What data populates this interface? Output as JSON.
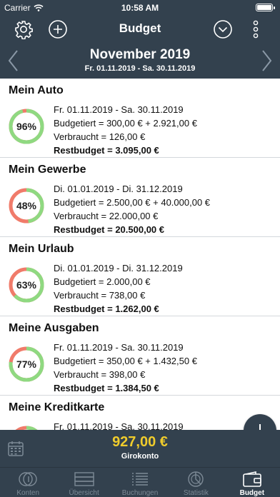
{
  "status": {
    "carrier": "Carrier",
    "time": "10:58 AM"
  },
  "header": {
    "title": "Budget"
  },
  "period": {
    "month": "November 2019",
    "range": "Fr. 01.11.2019 - Sa. 30.11.2019"
  },
  "colors": {
    "bar": "#33414e",
    "ring_ok": "#8fd981",
    "ring_used": "#f07b6a",
    "amount": "#f0cc2c"
  },
  "budgets": [
    {
      "name": "Mein Auto",
      "percent_label": "96%",
      "remaining_fraction": 0.96,
      "dates": "Fr. 01.11.2019 - Sa. 30.11.2019",
      "budgeted": "Budgetiert = 300,00 € + 2.921,00 €",
      "spent": "Verbraucht = 126,00 €",
      "rest": "Restbudget = 3.095,00 €"
    },
    {
      "name": "Mein Gewerbe",
      "percent_label": "48%",
      "remaining_fraction": 0.48,
      "dates": "Di. 01.01.2019 - Di. 31.12.2019",
      "budgeted": "Budgetiert = 2.500,00 € + 40.000,00 €",
      "spent": "Verbraucht = 22.000,00 €",
      "rest": "Restbudget = 20.500,00 €"
    },
    {
      "name": "Mein Urlaub",
      "percent_label": "63%",
      "remaining_fraction": 0.63,
      "dates": "Di. 01.01.2019 - Di. 31.12.2019",
      "budgeted": "Budgetiert = 2.000,00 €",
      "spent": "Verbraucht = 738,00 €",
      "rest": "Restbudget = 1.262,00 €"
    },
    {
      "name": "Meine Ausgaben",
      "percent_label": "77%",
      "remaining_fraction": 0.77,
      "dates": "Fr. 01.11.2019 - Sa. 30.11.2019",
      "budgeted": "Budgetiert = 350,00 € + 1.432,50 €",
      "spent": "Verbraucht = 398,00 €",
      "rest": "Restbudget = 1.384,50 €"
    },
    {
      "name": "Meine Kreditkarte",
      "percent_label": "",
      "remaining_fraction": 0.7,
      "dates": "Fr. 01.11.2019 - Sa. 30.11.2019",
      "budgeted": "",
      "spent": "",
      "rest": ""
    }
  ],
  "account": {
    "amount": "927,00 €",
    "name": "Girokonto"
  },
  "tabs": [
    {
      "label": "Konten",
      "icon": "coins-icon"
    },
    {
      "label": "Übersicht",
      "icon": "overview-icon"
    },
    {
      "label": "Buchungen",
      "icon": "list-icon"
    },
    {
      "label": "Statistik",
      "icon": "pie-chart-icon"
    },
    {
      "label": "Budget",
      "icon": "wallet-icon"
    }
  ]
}
